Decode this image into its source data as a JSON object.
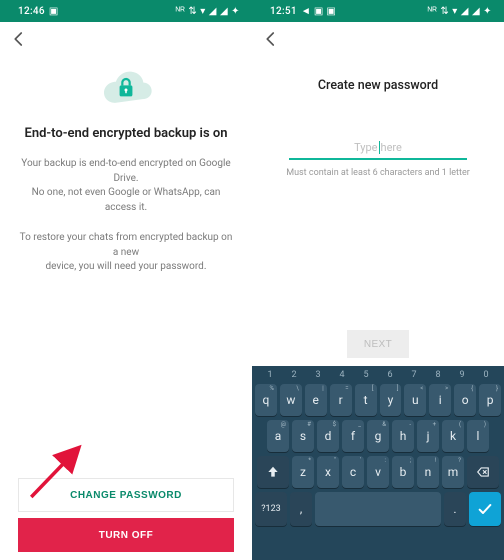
{
  "colors": {
    "brand": "#0a8a6b",
    "accent": "#0fb79a",
    "danger": "#e1234a",
    "kb_bg": "#24465a",
    "kb_key": "#38596e"
  },
  "left": {
    "status": {
      "time": "12:46",
      "left_icons": "▣",
      "right_icons": "ᴺᴿ ⇅ ▾ ◢ ◢ ✦"
    },
    "title": "End-to-end encrypted backup is on",
    "body1_line1": "Your backup is end-to-end encrypted on Google Drive.",
    "body1_line2": "No one, not even Google or WhatsApp, can access it.",
    "body2_line1": "To restore your chats from encrypted backup on a new",
    "body2_line2": "device, you will need your password.",
    "change_password": "CHANGE PASSWORD",
    "turn_off": "TURN OFF"
  },
  "right": {
    "status": {
      "time": "12:51",
      "left_icons": "◄ ▣ ▣",
      "right_icons": "ᴺᴿ ⇅ ▾ ◢ ◢ ✦"
    },
    "title": "Create new password",
    "placeholder": "Type here",
    "hint": "Must contain at least 6 characters and 1 letter",
    "next": "NEXT",
    "keyboard": {
      "numbers": [
        "1",
        "2",
        "3",
        "4",
        "5",
        "6",
        "7",
        "8",
        "9",
        "0"
      ],
      "row1": [
        {
          "k": "q",
          "s": "%"
        },
        {
          "k": "w",
          "s": "\\"
        },
        {
          "k": "e",
          "s": "|"
        },
        {
          "k": "r",
          "s": "="
        },
        {
          "k": "t",
          "s": "["
        },
        {
          "k": "y",
          "s": "]"
        },
        {
          "k": "u",
          "s": "<"
        },
        {
          "k": "i",
          "s": ">"
        },
        {
          "k": "o",
          "s": "{"
        },
        {
          "k": "p",
          "s": "}"
        }
      ],
      "row2": [
        {
          "k": "a",
          "s": "@"
        },
        {
          "k": "s",
          "s": "#"
        },
        {
          "k": "d",
          "s": "$"
        },
        {
          "k": "f",
          "s": "_"
        },
        {
          "k": "g",
          "s": "&"
        },
        {
          "k": "h",
          "s": "-"
        },
        {
          "k": "j",
          "s": "+"
        },
        {
          "k": "k",
          "s": "("
        },
        {
          "k": "l",
          "s": ")"
        }
      ],
      "row3": [
        {
          "k": "z",
          "s": "*"
        },
        {
          "k": "x",
          "s": "\""
        },
        {
          "k": "c",
          "s": "'"
        },
        {
          "k": "v",
          "s": ":"
        },
        {
          "k": "b",
          "s": ";"
        },
        {
          "k": "n",
          "s": "!"
        },
        {
          "k": "m",
          "s": "?"
        }
      ],
      "sym": "?123",
      "comma": ",",
      "period": ".",
      "shift": "⇧",
      "backspace": "⌫",
      "enter": "✓"
    }
  }
}
